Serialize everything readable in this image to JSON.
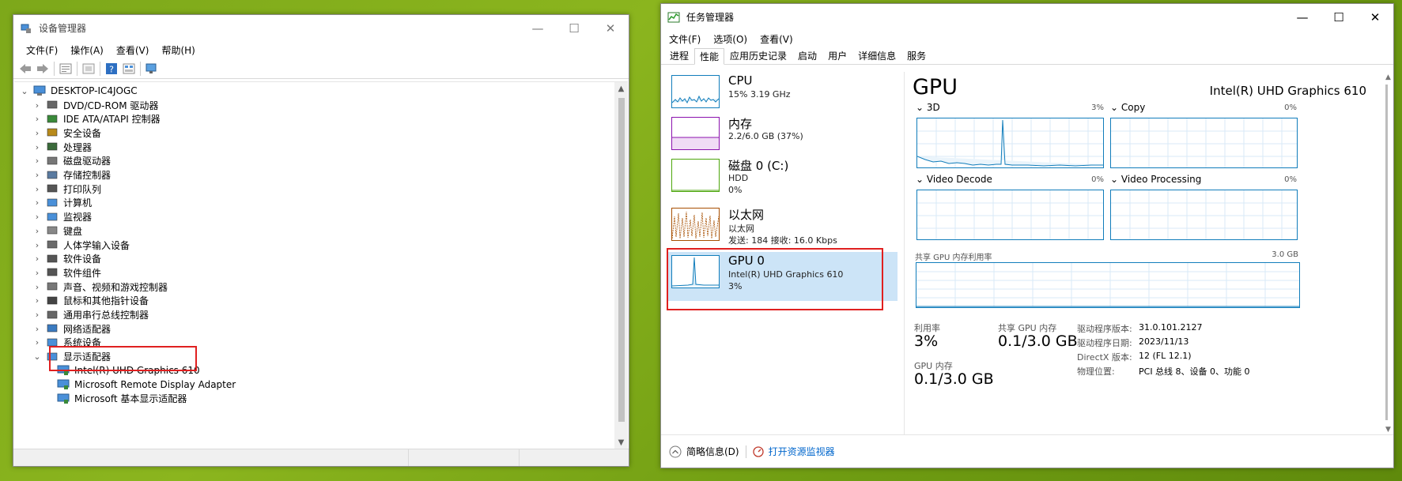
{
  "devmgr": {
    "title": "设备管理器",
    "menu": [
      "文件(F)",
      "操作(A)",
      "查看(V)",
      "帮助(H)"
    ],
    "root": "DESKTOP-IC4JOGC",
    "tree": [
      {
        "label": "DVD/CD-ROM 驱动器",
        "icon": "dvd-icon"
      },
      {
        "label": "IDE ATA/ATAPI 控制器",
        "icon": "ide-controller-icon"
      },
      {
        "label": "安全设备",
        "icon": "security-device-icon"
      },
      {
        "label": "处理器",
        "icon": "processor-icon"
      },
      {
        "label": "磁盘驱动器",
        "icon": "disk-drive-icon"
      },
      {
        "label": "存储控制器",
        "icon": "storage-controller-icon"
      },
      {
        "label": "打印队列",
        "icon": "printer-icon"
      },
      {
        "label": "计算机",
        "icon": "computer-icon"
      },
      {
        "label": "监视器",
        "icon": "monitor-icon"
      },
      {
        "label": "键盘",
        "icon": "keyboard-icon"
      },
      {
        "label": "人体学输入设备",
        "icon": "hid-icon"
      },
      {
        "label": "软件设备",
        "icon": "software-device-icon"
      },
      {
        "label": "软件组件",
        "icon": "software-component-icon"
      },
      {
        "label": "声音、视频和游戏控制器",
        "icon": "audio-icon"
      },
      {
        "label": "鼠标和其他指针设备",
        "icon": "mouse-icon"
      },
      {
        "label": "通用串行总线控制器",
        "icon": "usb-icon"
      },
      {
        "label": "网络适配器",
        "icon": "network-adapter-icon"
      },
      {
        "label": "系统设备",
        "icon": "system-device-icon"
      },
      {
        "label": "显示适配器",
        "icon": "display-adapter-icon"
      }
    ],
    "display_children": [
      "Intel(R) UHD Graphics 610",
      "Microsoft Remote Display Adapter",
      "Microsoft 基本显示适配器"
    ]
  },
  "taskmgr": {
    "title": "任务管理器",
    "menu": [
      "文件(F)",
      "选项(O)",
      "查看(V)"
    ],
    "tabs": [
      "进程",
      "性能",
      "应用历史记录",
      "启动",
      "用户",
      "详细信息",
      "服务"
    ],
    "active_tab": "性能",
    "perf_items": [
      {
        "name": "CPU",
        "lines": [
          "15% 3.19 GHz"
        ],
        "color": "#117dbb"
      },
      {
        "name": "内存",
        "lines": [
          "2.2/6.0 GB (37%)"
        ],
        "color": "#8b12ae"
      },
      {
        "name": "磁盘 0 (C:)",
        "lines": [
          "HDD",
          "0%"
        ],
        "color": "#4da60c"
      },
      {
        "name": "以太网",
        "lines": [
          "以太网",
          "发送: 184  接收: 16.0 Kbps"
        ],
        "color": "#a74f01"
      },
      {
        "name": "GPU 0",
        "lines": [
          "Intel(R) UHD Graphics 610",
          "3%"
        ],
        "color": "#117dbb"
      }
    ],
    "gpu_title": "GPU",
    "gpu_model": "Intel(R) UHD Graphics 610",
    "engines": [
      {
        "name": "3D",
        "pct": "3%"
      },
      {
        "name": "Copy",
        "pct": "0%"
      },
      {
        "name": "Video Decode",
        "pct": "0%"
      },
      {
        "name": "Video Processing",
        "pct": "0%"
      }
    ],
    "shared_mem_label": "共享 GPU 内存利用率",
    "shared_mem_max": "3.0 GB",
    "stats": {
      "util_label": "利用率",
      "util_value": "3%",
      "shared_label": "共享 GPU 内存",
      "shared_value": "0.1/3.0 GB",
      "gpumem_label": "GPU 内存",
      "gpumem_value": "0.1/3.0 GB"
    },
    "info": [
      {
        "label": "驱动程序版本:",
        "value": "31.0.101.2127"
      },
      {
        "label": "驱动程序日期:",
        "value": "2023/11/13"
      },
      {
        "label": "DirectX 版本:",
        "value": "12 (FL 12.1)"
      },
      {
        "label": "物理位置:",
        "value": "PCI 总线 8、设备 0、功能 0"
      }
    ],
    "footer_summary": "简略信息(D)",
    "footer_link": "打开资源监视器"
  }
}
